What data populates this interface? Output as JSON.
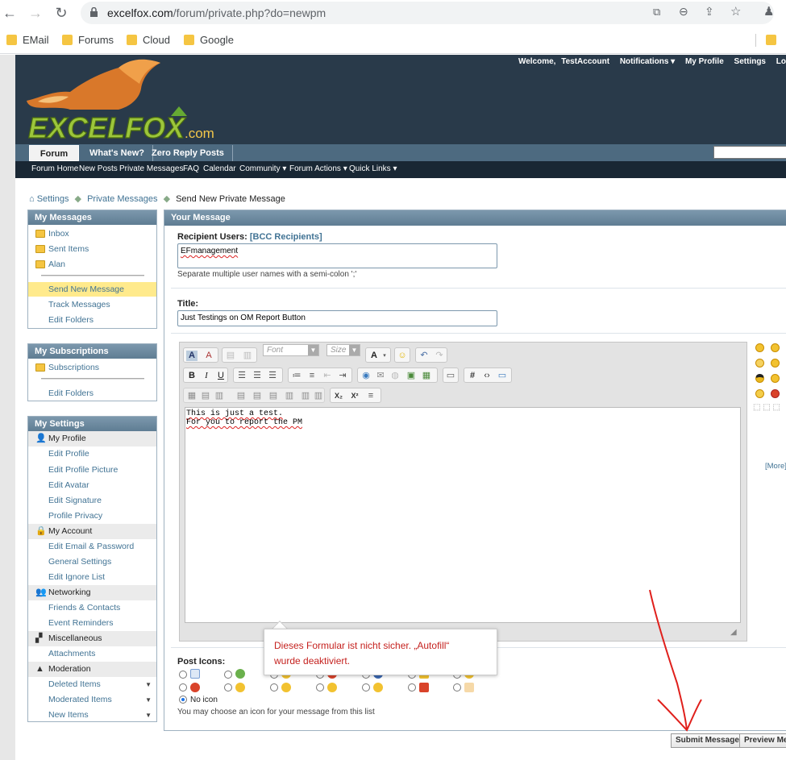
{
  "browser": {
    "url_host": "excelfox.com",
    "url_path": "/forum/private.php?do=newpm",
    "bookmarks": [
      "EMail",
      "Forums",
      "Cloud",
      "Google"
    ]
  },
  "header": {
    "welcome": "Welcome,",
    "username": "TestAccount",
    "notifications": "Notifications ▾",
    "my_profile": "My Profile",
    "settings": "Settings",
    "logout": "Lo",
    "logo_text": "EXCELFOX",
    "logo_suffix": ".com",
    "tabs": [
      "Forum",
      "What's New?",
      "Zero Reply Posts"
    ],
    "subnav": [
      "Forum Home",
      "New Posts",
      "Private Messages",
      "FAQ",
      "Calendar",
      "Community ▾",
      "Forum Actions ▾",
      "Quick Links ▾"
    ]
  },
  "breadcrumb": [
    "Settings",
    "Private Messages",
    "Send New Private Message"
  ],
  "sidebar": {
    "messages_title": "My Messages",
    "messages": [
      "Inbox",
      "Sent Items",
      "Alan",
      "Send New Message",
      "Track Messages",
      "Edit Folders"
    ],
    "subs_title": "My Subscriptions",
    "subs": [
      "Subscriptions",
      "Edit Folders"
    ],
    "settings_title": "My Settings",
    "profile_sec": "My Profile",
    "profile_items": [
      "Edit Profile",
      "Edit Profile Picture",
      "Edit Avatar",
      "Edit Signature",
      "Profile Privacy"
    ],
    "account_sec": "My Account",
    "account_items": [
      "Edit Email & Password",
      "General Settings",
      "Edit Ignore List"
    ],
    "networking_sec": "Networking",
    "networking_items": [
      "Friends & Contacts",
      "Event Reminders"
    ],
    "misc_sec": "Miscellaneous",
    "misc_items": [
      "Attachments"
    ],
    "moderation_sec": "Moderation",
    "moderation_items": [
      "Deleted Items",
      "Moderated Items",
      "New Items"
    ]
  },
  "form": {
    "panel_title": "Your Message",
    "recipient_label": "Recipient Users:",
    "bcc_link": "[BCC Recipients]",
    "recipient_value": "EFmanagement",
    "recipient_hint": "Separate multiple user names with a semi-colon ';'",
    "title_label": "Title:",
    "title_value": "Just Testings on OM Report Button",
    "font_placeholder": "Font",
    "size_placeholder": "Size",
    "body_line1": "This is just a test.",
    "body_line2": "For you to report the PM",
    "more_smilies": "[More]",
    "post_icons_label": "Post Icons:",
    "no_icon_label": "No icon",
    "post_icons_hint": "You may choose an icon for your message from this list",
    "submit": "Submit Message",
    "preview": "Preview Me"
  },
  "tooltip": {
    "line1": "Dieses Formular ist nicht sicher. „Autofill“",
    "line2": "wurde deaktiviert."
  },
  "colors": {
    "accent": "#417394",
    "header_bg": "#293a4a",
    "selected_bg": "#ffea8c",
    "warning": "#c5221f"
  }
}
